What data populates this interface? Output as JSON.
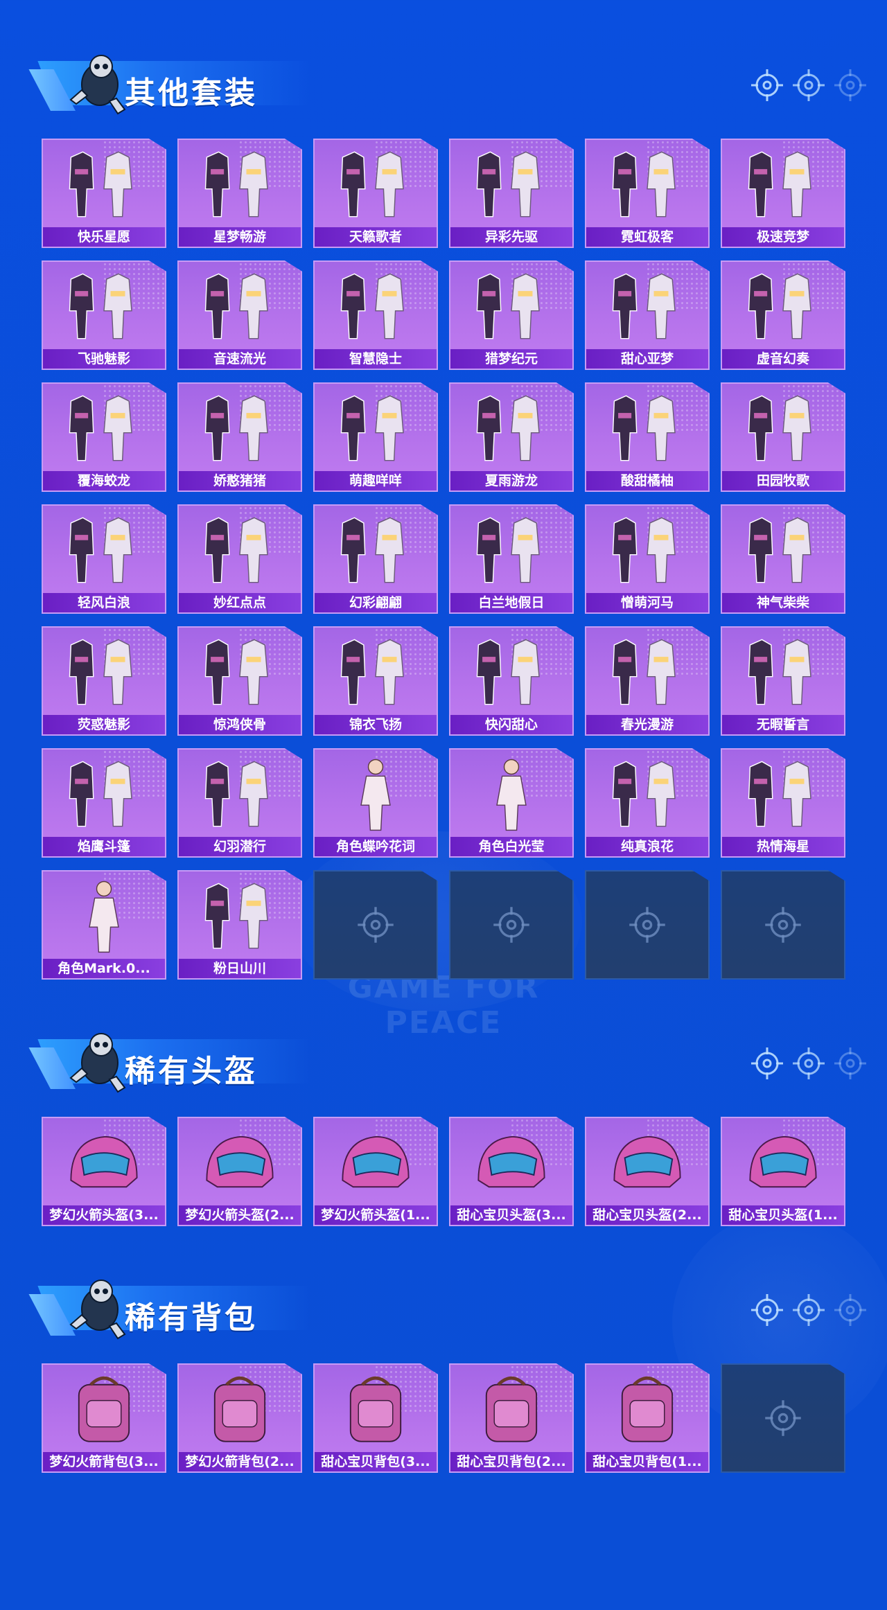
{
  "watermark": "GAME FOR PEACE",
  "colors": {
    "background": "#0a4fdf",
    "card_purple": "#b774ec",
    "label_purple": "#7a2fd6",
    "empty_slot": "#1f3f74",
    "header_banner": "#2fa3ff"
  },
  "sections": [
    {
      "id": "outfits",
      "title": "其他套装",
      "items": [
        {
          "name": "快乐星愿",
          "icon": "outfit-icon"
        },
        {
          "name": "星梦畅游",
          "icon": "outfit-icon"
        },
        {
          "name": "天籁歌者",
          "icon": "outfit-icon"
        },
        {
          "name": "异彩先驱",
          "icon": "outfit-icon"
        },
        {
          "name": "霓虹极客",
          "icon": "outfit-icon"
        },
        {
          "name": "极速竞梦",
          "icon": "outfit-icon"
        },
        {
          "name": "飞驰魅影",
          "icon": "outfit-icon"
        },
        {
          "name": "音速流光",
          "icon": "outfit-icon"
        },
        {
          "name": "智慧隐士",
          "icon": "outfit-icon"
        },
        {
          "name": "猎梦纪元",
          "icon": "outfit-icon"
        },
        {
          "name": "甜心亚梦",
          "icon": "outfit-icon"
        },
        {
          "name": "虚音幻奏",
          "icon": "outfit-icon"
        },
        {
          "name": "覆海蛟龙",
          "icon": "outfit-icon"
        },
        {
          "name": "娇憨猪猪",
          "icon": "outfit-icon"
        },
        {
          "name": "萌趣咩咩",
          "icon": "outfit-icon"
        },
        {
          "name": "夏雨游龙",
          "icon": "outfit-icon"
        },
        {
          "name": "酸甜橘柚",
          "icon": "outfit-icon"
        },
        {
          "name": "田园牧歌",
          "icon": "outfit-icon"
        },
        {
          "name": "轻风白浪",
          "icon": "outfit-icon"
        },
        {
          "name": "妙红点点",
          "icon": "outfit-icon"
        },
        {
          "name": "幻彩翩翩",
          "icon": "outfit-icon"
        },
        {
          "name": "白兰地假日",
          "icon": "outfit-icon"
        },
        {
          "name": "憎萌河马",
          "icon": "outfit-icon"
        },
        {
          "name": "神气柴柴",
          "icon": "outfit-icon"
        },
        {
          "name": "荧惑魅影",
          "icon": "outfit-icon"
        },
        {
          "name": "惊鸿侠骨",
          "icon": "outfit-icon"
        },
        {
          "name": "锦衣飞扬",
          "icon": "outfit-icon"
        },
        {
          "name": "快闪甜心",
          "icon": "outfit-icon"
        },
        {
          "name": "春光漫游",
          "icon": "outfit-icon"
        },
        {
          "name": "无暇誓言",
          "icon": "outfit-icon"
        },
        {
          "name": "焰鹰斗篷",
          "icon": "outfit-icon"
        },
        {
          "name": "幻羽潜行",
          "icon": "outfit-icon"
        },
        {
          "name": "角色蝶吟花词",
          "icon": "character-icon"
        },
        {
          "name": "角色白光莹",
          "icon": "character-icon"
        },
        {
          "name": "纯真浪花",
          "icon": "outfit-icon"
        },
        {
          "name": "热情海星",
          "icon": "outfit-icon"
        },
        {
          "name": "角色Mark.0...",
          "icon": "character-icon"
        },
        {
          "name": "粉日山川",
          "icon": "outfit-icon"
        }
      ],
      "empty_slots": 4
    },
    {
      "id": "helmets",
      "title": "稀有头盔",
      "items": [
        {
          "name": "梦幻火箭头盔(3...",
          "icon": "helmet-icon"
        },
        {
          "name": "梦幻火箭头盔(2...",
          "icon": "helmet-icon"
        },
        {
          "name": "梦幻火箭头盔(1...",
          "icon": "helmet-icon"
        },
        {
          "name": "甜心宝贝头盔(3...",
          "icon": "helmet-icon"
        },
        {
          "name": "甜心宝贝头盔(2...",
          "icon": "helmet-icon"
        },
        {
          "name": "甜心宝贝头盔(1...",
          "icon": "helmet-icon"
        }
      ],
      "empty_slots": 0
    },
    {
      "id": "backpacks",
      "title": "稀有背包",
      "items": [
        {
          "name": "梦幻火箭背包(3...",
          "icon": "backpack-icon"
        },
        {
          "name": "梦幻火箭背包(2...",
          "icon": "backpack-icon"
        },
        {
          "name": "甜心宝贝背包(3...",
          "icon": "backpack-icon"
        },
        {
          "name": "甜心宝贝背包(2...",
          "icon": "backpack-icon"
        },
        {
          "name": "甜心宝贝背包(1...",
          "icon": "backpack-icon"
        }
      ],
      "empty_slots": 1
    }
  ]
}
